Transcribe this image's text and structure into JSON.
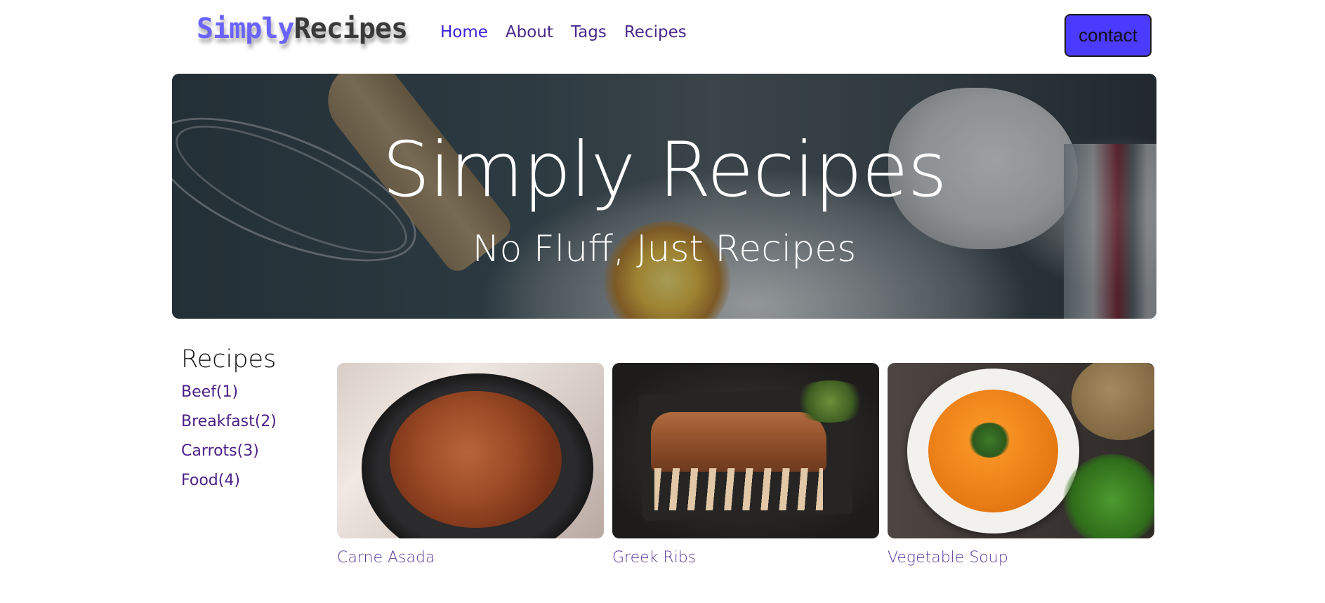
{
  "header": {
    "logo_part1": "Simply",
    "logo_part2": "Recipes",
    "nav": [
      {
        "label": "Home"
      },
      {
        "label": "About"
      },
      {
        "label": "Tags"
      },
      {
        "label": "Recipes"
      }
    ],
    "contact_label": "contact"
  },
  "hero": {
    "title": "Simply Recipes",
    "subtitle": "No Fluff, Just Recipes"
  },
  "sidebar": {
    "title": "Recipes",
    "tags": [
      {
        "label": "Beef(1)"
      },
      {
        "label": "Breakfast(2)"
      },
      {
        "label": "Carrots(3)"
      },
      {
        "label": "Food(4)"
      }
    ]
  },
  "recipes": [
    {
      "title": "Carne Asada"
    },
    {
      "title": "Greek Ribs"
    },
    {
      "title": "Vegetable Soup"
    }
  ],
  "colors": {
    "brand": "#6b63ff",
    "contact_button": "#4b3bff",
    "link": "#4a1f86"
  }
}
